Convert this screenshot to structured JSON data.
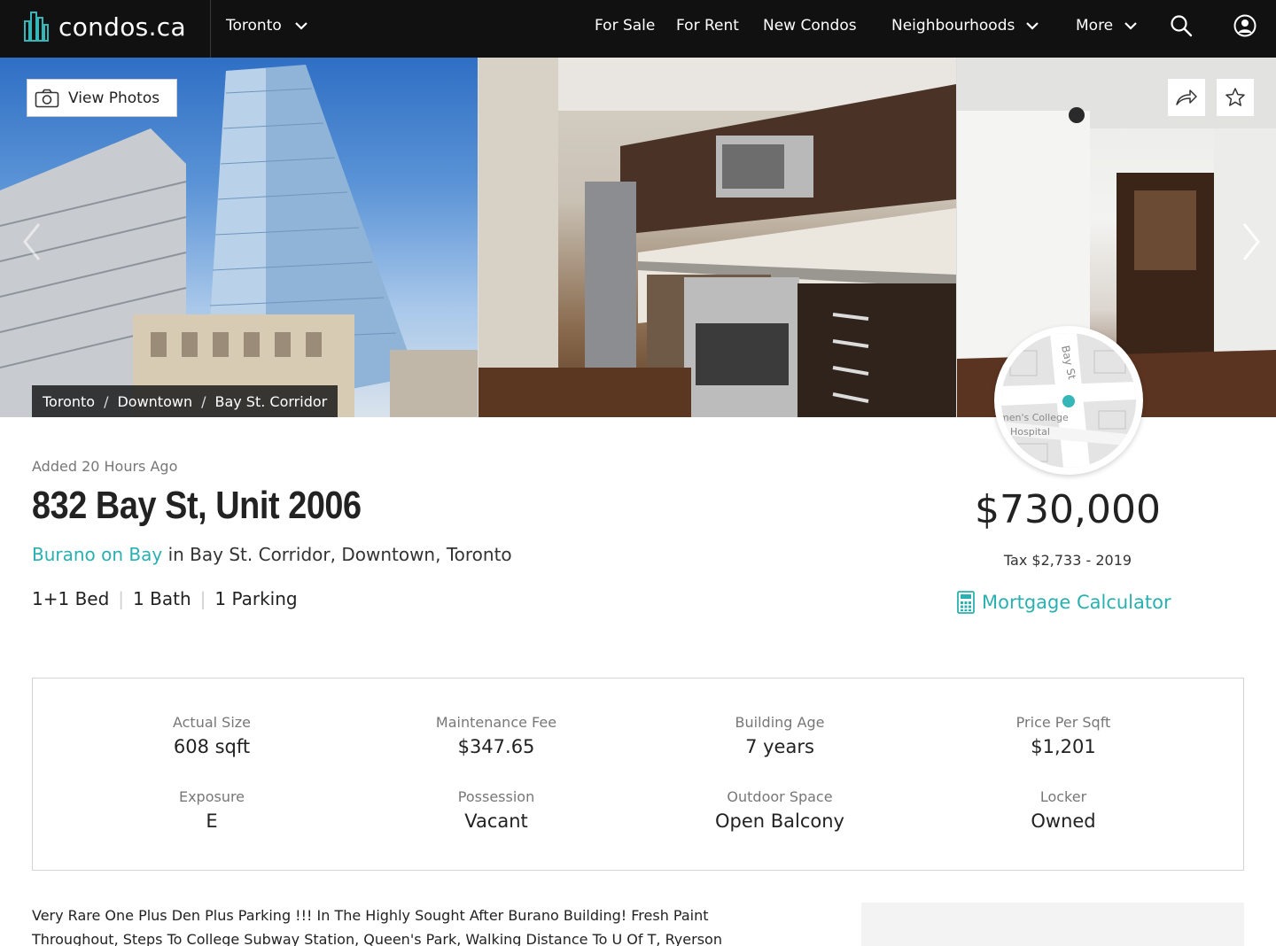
{
  "nav": {
    "logo_text": "condos.ca",
    "city": "Toronto",
    "links": {
      "for_sale": "For Sale",
      "for_rent": "For Rent",
      "new_condos": "New Condos",
      "neighbourhoods": "Neighbourhoods",
      "more": "More"
    },
    "icons": [
      "search-icon",
      "user-account-icon",
      "chevron-down-icon"
    ]
  },
  "gallery": {
    "view_photos_label": "View Photos",
    "breadcrumb": [
      "Toronto",
      "Downtown",
      "Bay St. Corridor"
    ],
    "breadcrumb_sep": "/",
    "icons": [
      "camera-icon",
      "share-icon",
      "star-icon",
      "chevron-right-icon"
    ]
  },
  "map": {
    "street_label": "Bay St",
    "poi_label_line1": "men's College",
    "poi_label_line2": "Hospital"
  },
  "listing": {
    "added": "Added 20 Hours Ago",
    "address": "832 Bay St, Unit 2006",
    "building_name": "Burano on Bay",
    "location_rest": " in Bay St. Corridor, Downtown, Toronto",
    "features": [
      "1+1 Bed",
      "1 Bath",
      "1 Parking"
    ],
    "feature_sep": "|",
    "price": "$730,000",
    "tax": "Tax $2,733 - 2019",
    "mortgage_label": "Mortgage Calculator"
  },
  "stats": [
    {
      "label": "Actual Size",
      "value": "608 sqft"
    },
    {
      "label": "Maintenance Fee",
      "value": "$347.65"
    },
    {
      "label": "Building Age",
      "value": "7 years"
    },
    {
      "label": "Price Per Sqft",
      "value": "$1,201"
    },
    {
      "label": "Exposure",
      "value": "E"
    },
    {
      "label": "Possession",
      "value": "Vacant"
    },
    {
      "label": "Outdoor Space",
      "value": "Open Balcony"
    },
    {
      "label": "Locker",
      "value": "Owned"
    }
  ],
  "description": {
    "line1": "Very Rare One Plus Den Plus Parking !!! In The Highly Sought After Burano Building! Fresh Paint",
    "line2": "Throughout, Steps To College Subway Station, Queen's Park, Walking Distance To U Of T, Ryerson"
  },
  "colors": {
    "accent": "#2ab0b0",
    "nav_bg": "#111111"
  }
}
